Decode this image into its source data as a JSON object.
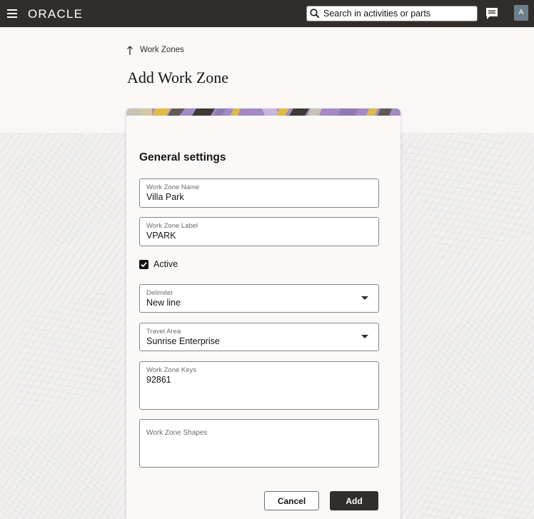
{
  "header": {
    "brand": "ORACLE",
    "search_placeholder": "Search in activities or parts",
    "avatar_initial": "A"
  },
  "breadcrumb": {
    "label": "Work Zones"
  },
  "page": {
    "title": "Add Work Zone"
  },
  "form": {
    "section_title": "General settings",
    "name": {
      "label": "Work Zone Name",
      "value": "Villa Park"
    },
    "zone_label": {
      "label": "Work Zone Label",
      "value": "VPARK"
    },
    "active": {
      "label": "Active",
      "checked": true
    },
    "delimiter": {
      "label": "Delimiter",
      "value": "New line"
    },
    "travel_area": {
      "label": "Travel Area",
      "value": "Sunrise Enterprise"
    },
    "keys": {
      "label": "Work Zone Keys",
      "value": "92861"
    },
    "shapes": {
      "label": "Work Zone Shapes",
      "value": ""
    }
  },
  "actions": {
    "cancel": "Cancel",
    "add": "Add"
  },
  "colors": {
    "header_bg": "#312d2a",
    "primary_button": "#312d2a",
    "banner_accent": "#a38ac3"
  }
}
